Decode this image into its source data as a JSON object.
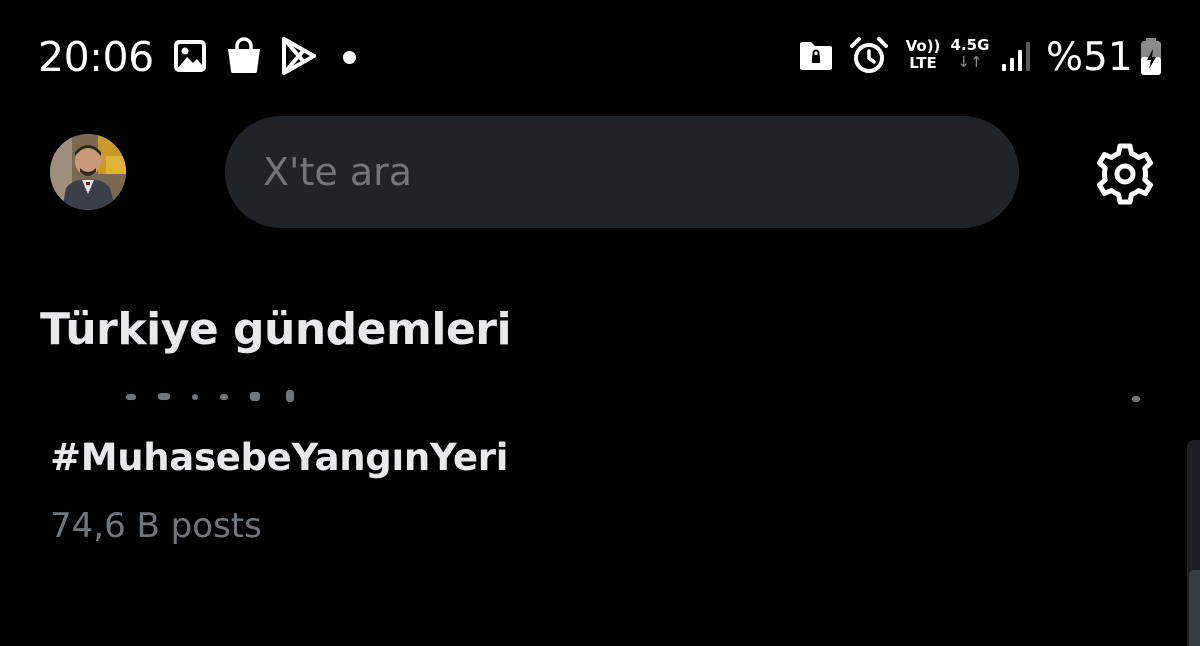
{
  "status_bar": {
    "time": "20:06",
    "icons": [
      "gallery-icon",
      "shopping-bag-icon",
      "play-store-icon",
      "notification-dot-icon",
      "folder-lock-icon",
      "alarm-icon",
      "volte-icon",
      "network-4-5g-icon",
      "signal-icon",
      "battery-charging-icon"
    ],
    "volte_line1": "Vo))",
    "volte_line2": "LTE",
    "network_type": "4.5G",
    "network_arrows": "↓↑",
    "battery": "%51"
  },
  "header": {
    "search_placeholder": "X'te ara",
    "settings_icon": "gear-icon"
  },
  "trends": {
    "section_title": "Türkiye gündemleri",
    "items": [
      {
        "name": "#MuhasebeYangınYeri",
        "posts": "74,6 B posts"
      }
    ]
  },
  "colors": {
    "background": "#000000",
    "search_bg": "#202327",
    "primary_text": "#e7e9ea",
    "secondary_text": "#71767b"
  }
}
